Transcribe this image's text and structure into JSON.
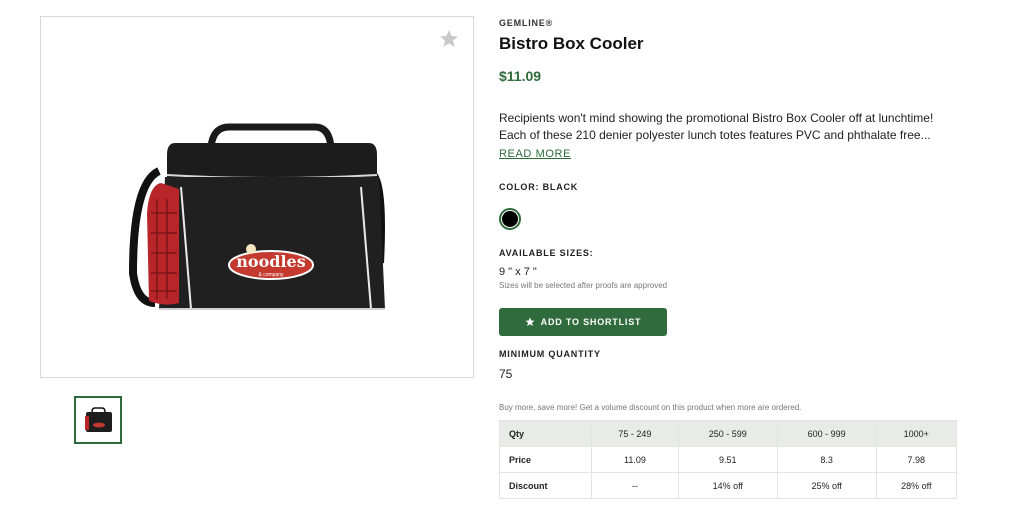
{
  "product": {
    "brand": "GEMLINE®",
    "title": "Bistro Box Cooler",
    "price": "$11.09",
    "description": "Recipients won't mind showing the promotional Bistro Box Cooler off at lunchtime! Each of these 210 denier polyester lunch totes features PVC and phthalate free...",
    "read_more": "READ MORE",
    "logo_text": "noodles",
    "logo_subtext": "& company"
  },
  "color": {
    "label": "COLOR: BLACK",
    "swatch": "#000000"
  },
  "sizes": {
    "label": "AVAILABLE SIZES:",
    "value": "9 \" x 7 \"",
    "note": "Sizes will be selected after proofs are approved"
  },
  "shortlist": {
    "label": "ADD TO SHORTLIST",
    "icon": "star-icon"
  },
  "minimum": {
    "label": "MINIMUM QUANTITY",
    "value": "75"
  },
  "volume_note": "Buy more, save more! Get a volume discount on this product when more are ordered.",
  "pricing_table": {
    "rows": [
      [
        "Qty",
        "75 - 249",
        "250 - 599",
        "600 - 999",
        "1000+"
      ],
      [
        "Price",
        "11.09",
        "9.51",
        "8.3",
        "7.98"
      ],
      [
        "Discount",
        "--",
        "14% off",
        "25% off",
        "28% off"
      ]
    ]
  },
  "colors": {
    "accent": "#2f6b3c",
    "border": "#d8d8d8",
    "header_bg": "#e8ebe8"
  }
}
